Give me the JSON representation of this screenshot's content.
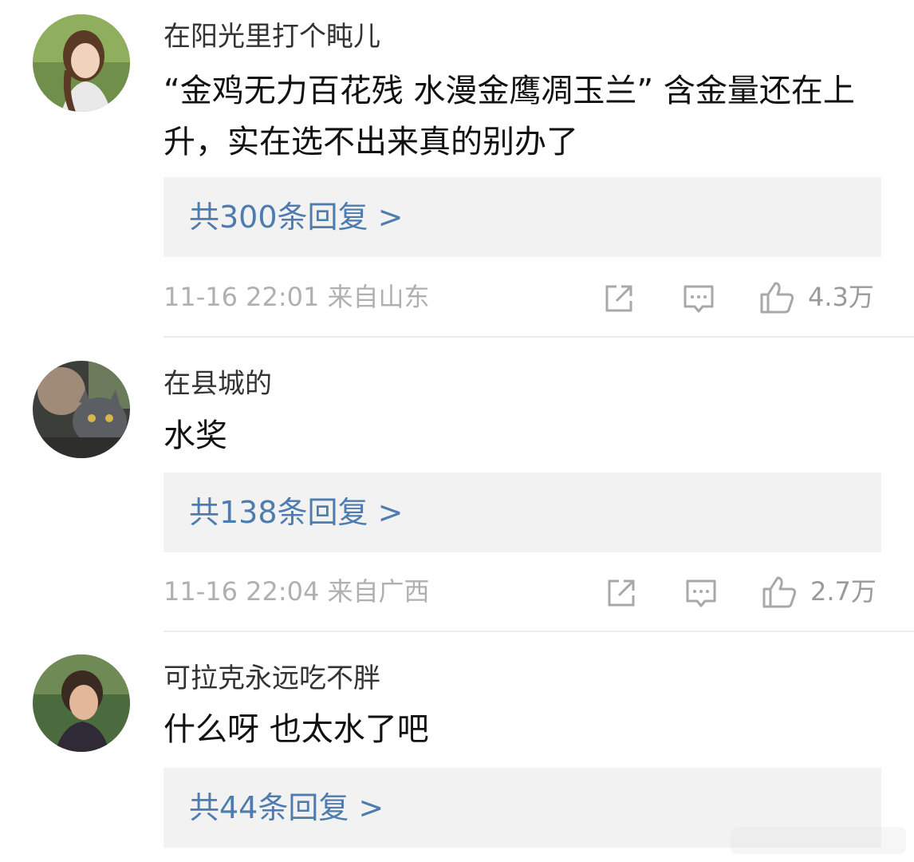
{
  "comments": [
    {
      "username": "在阳光里打个盹儿",
      "text": "“金鸡无力百花残 水漫金鹰凋玉兰” 含金量还在上升，实在选不出来真的别办了",
      "replies_label": "共300条回复 >",
      "meta": "11-16 22:01 来自山东",
      "likes": "4.3万",
      "avatar_icon": "avatar-woman-photo-icon"
    },
    {
      "username": "在县城的",
      "text": "水奖",
      "replies_label": "共138条回复 >",
      "meta": "11-16 22:04 来自广西",
      "likes": "2.7万",
      "avatar_icon": "avatar-cat-photo-icon"
    },
    {
      "username": "可拉克永远吃不胖",
      "text": "什么呀 也太水了吧",
      "replies_label": "共44条回复 >",
      "avatar_icon": "avatar-person-photo-icon"
    }
  ],
  "icons": {
    "share": "share-icon",
    "comment": "comment-icon",
    "like": "like-icon"
  },
  "colors": {
    "reply_link": "#4e7cae",
    "meta_text": "#b0b0b0",
    "reply_bg": "#f2f2f2"
  }
}
